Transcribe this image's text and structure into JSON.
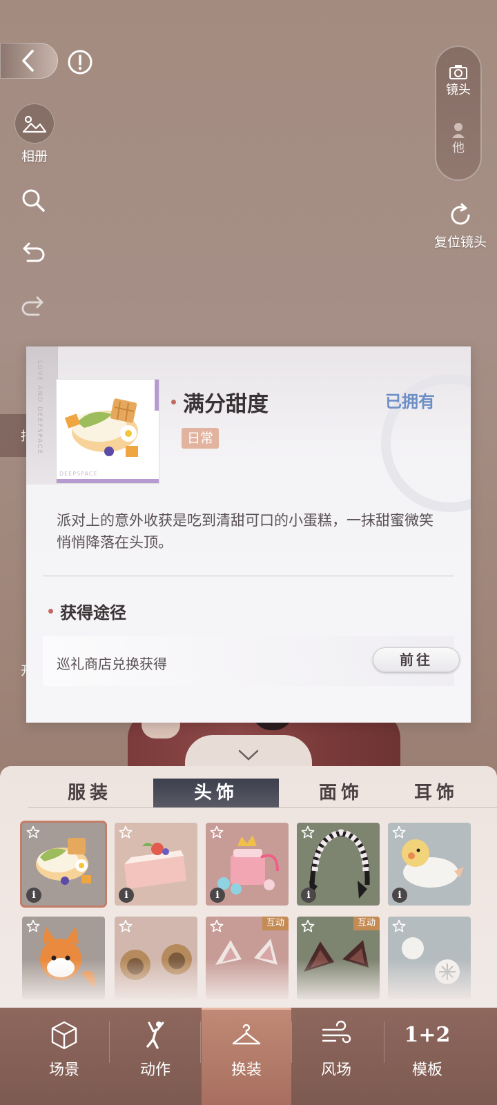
{
  "left_controls": {
    "album_label": "相册"
  },
  "right_controls": {
    "camera_label": "镜头",
    "other_label": "他",
    "reset_label": "复位镜头"
  },
  "card": {
    "corner_text": "LOVE AND DEEPSPACE",
    "thumb_brand": "DEEPSPACE",
    "item_name": "满分甜度",
    "owned_status": "已拥有",
    "category_tag": "日常",
    "description": "派对上的意外收获是吃到清甜可口的小蛋糕，一抹甜蜜微笑悄悄降落在头顶。",
    "source_heading": "获得途径",
    "source_text": "巡礼商店兑换获得",
    "goto_label": "前往"
  },
  "wardrobe": {
    "tabs": [
      {
        "label": "服装",
        "active": false
      },
      {
        "label": "头饰",
        "active": true
      },
      {
        "label": "面饰",
        "active": false
      },
      {
        "label": "耳饰",
        "active": false
      }
    ],
    "interactive_badge": "互动",
    "info_glyph": "i"
  },
  "nav": {
    "items": [
      {
        "label": "场景",
        "icon": "cube-icon"
      },
      {
        "label": "动作",
        "icon": "pose-figure-icon"
      },
      {
        "label": "换装",
        "icon": "hanger-icon",
        "active": true
      },
      {
        "label": "风场",
        "icon": "wind-icon"
      },
      {
        "label": "模板",
        "icon": "template-1plus2-icon",
        "glyph": "1+2"
      }
    ]
  },
  "peek": {
    "left_text_1": "指",
    "left_text_2": "开"
  }
}
